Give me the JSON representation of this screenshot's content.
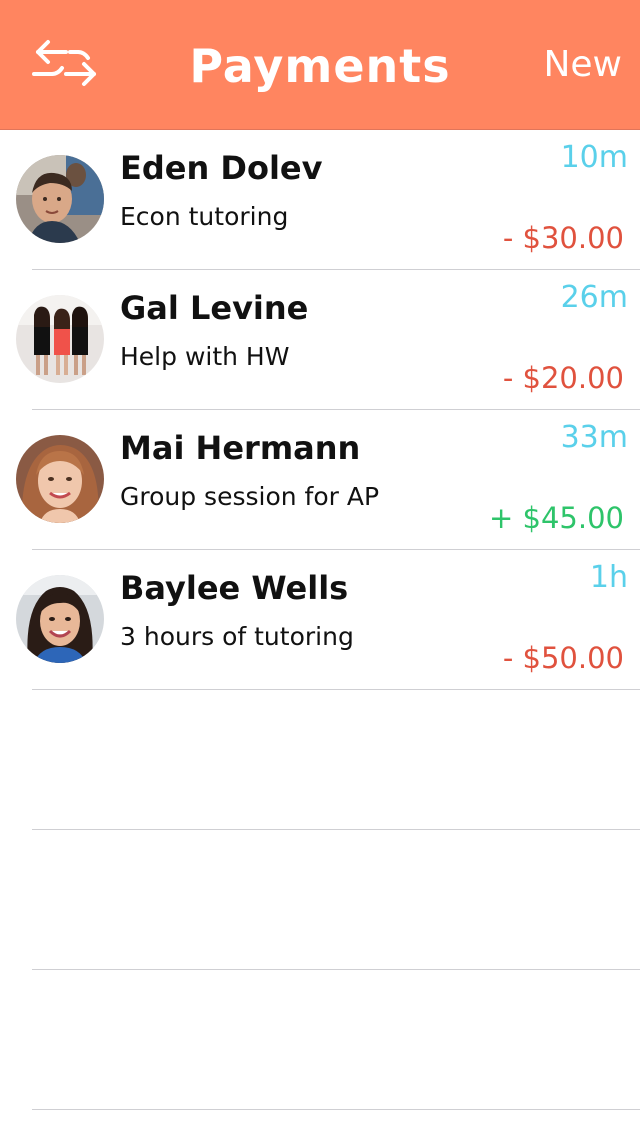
{
  "header": {
    "title": "Payments",
    "new_label": "New",
    "menu_icon": "swap-arrows-icon",
    "background_color": "#ff8560"
  },
  "payments": [
    {
      "name": "Eden Dolev",
      "description": "Econ tutoring",
      "time": "10m",
      "amount": "- $30.00",
      "direction": "outgoing"
    },
    {
      "name": "Gal Levine",
      "description": "Help with HW",
      "time": "26m",
      "amount": "- $20.00",
      "direction": "outgoing"
    },
    {
      "name": "Mai Hermann",
      "description": "Group session for AP",
      "time": "33m",
      "amount": "+ $45.00",
      "direction": "incoming"
    },
    {
      "name": "Baylee Wells",
      "description": "3 hours of tutoring",
      "time": "1h",
      "amount": "- $50.00",
      "direction": "outgoing"
    }
  ],
  "colors": {
    "time": "#5ad0ea",
    "negative": "#e0523e",
    "positive": "#2ec46a",
    "divider": "#cfcfd3"
  }
}
